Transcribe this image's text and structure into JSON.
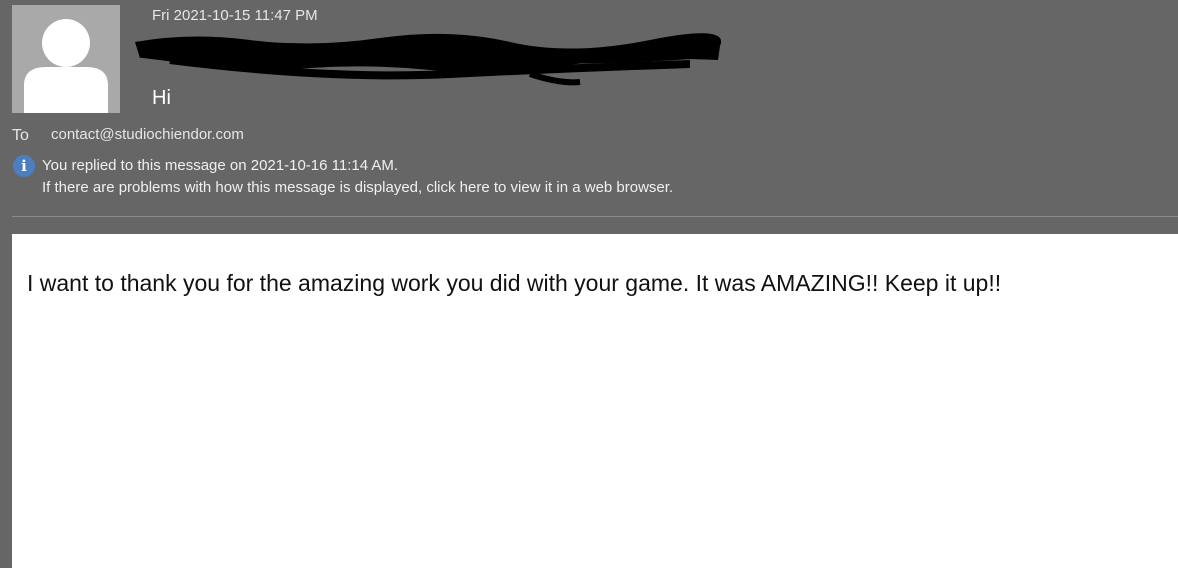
{
  "header": {
    "date": "Fri 2021-10-15 11:47 PM",
    "subject": "Hi",
    "to_label": "To",
    "to_value": "contact@studiochiendor.com"
  },
  "info": {
    "icon": "info-icon",
    "icon_glyph": "i",
    "replied": "You replied to this message on 2021-10-16 11:14 AM.",
    "browser_notice": "If there are problems with how this message is displayed, click here to view it in a web browser."
  },
  "message": {
    "body": "I want to thank you for the amazing work you did with your game. It was AMAZING!! Keep it up!!"
  },
  "colors": {
    "header_bg": "#666666",
    "info_icon": "#4b7fc0",
    "body_bg": "#ffffff"
  }
}
